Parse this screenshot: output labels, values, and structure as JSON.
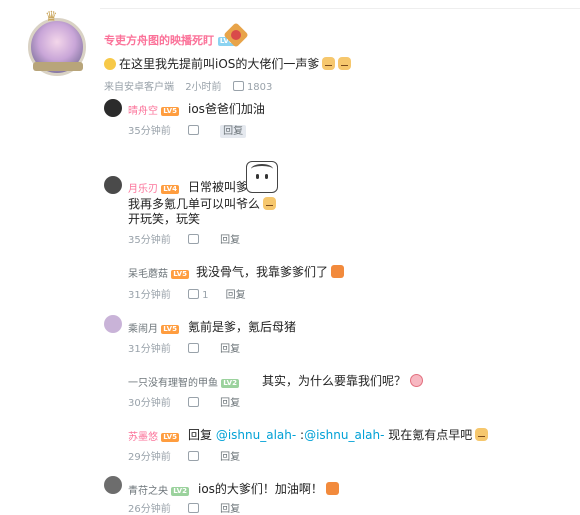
{
  "main_comment": {
    "username": "专吏方舟图的映播死盯",
    "level_badge": "LV6",
    "text": "在这里我先提前叫iOS的大佬们一声爹",
    "source": "来自安卓客户端",
    "time": "2小时前",
    "likes": "1803"
  },
  "replies": [
    {
      "username": "晴舟空",
      "level": "LV5",
      "text": "ios爸爸们加油",
      "time": "35分钟前",
      "likes": "",
      "reply_label": "回复"
    },
    {
      "username": "月乐刃",
      "level": "LV4",
      "text_line1": "日常被叫爹",
      "text_line2": "我再多氪几单可以叫爷么",
      "text_line3": "开玩笑，玩笑",
      "time": "35分钟前",
      "likes": "",
      "reply_label": "回复"
    },
    {
      "username": "呆毛蘑菇",
      "level": "LV5",
      "text": "我没骨气，我靠爹爹们了",
      "time": "31分钟前",
      "likes": "1",
      "reply_label": "回复"
    },
    {
      "username": "乘闹月",
      "level": "LV5",
      "text": "氪前是爹，氪后母猪",
      "time": "31分钟前",
      "likes": "",
      "reply_label": "回复"
    },
    {
      "username": "一只没有理智的甲鱼",
      "level": "LV2",
      "text": "其实，为什么要靠我们呢？",
      "time": "30分钟前",
      "likes": "",
      "reply_label": "回复"
    },
    {
      "username": "苏墨悠",
      "level": "LV5",
      "text_prefix": "回复 ",
      "mention1": "@ishnu_alah-",
      "mid": " :",
      "mention2": "@ishnu_alah-",
      "text_suffix": " 现在氪有点早吧",
      "time": "29分钟前",
      "likes": "",
      "reply_label": "回复"
    },
    {
      "username": "青苻之央",
      "level": "LV2",
      "text": "ios的大爹们！加油啊！",
      "time": "26分钟前",
      "likes": "",
      "reply_label": "回复"
    }
  ],
  "colors": {
    "accent": "#fb7299",
    "link": "#00a1d6",
    "meta": "#99a2aa"
  },
  "icons": [
    "smile-emoji-icon",
    "dog-emoji-icon",
    "thumbs-up-icon",
    "angry-emoji-icon",
    "love-emoji-icon",
    "medal-icon",
    "sticker-icon"
  ]
}
